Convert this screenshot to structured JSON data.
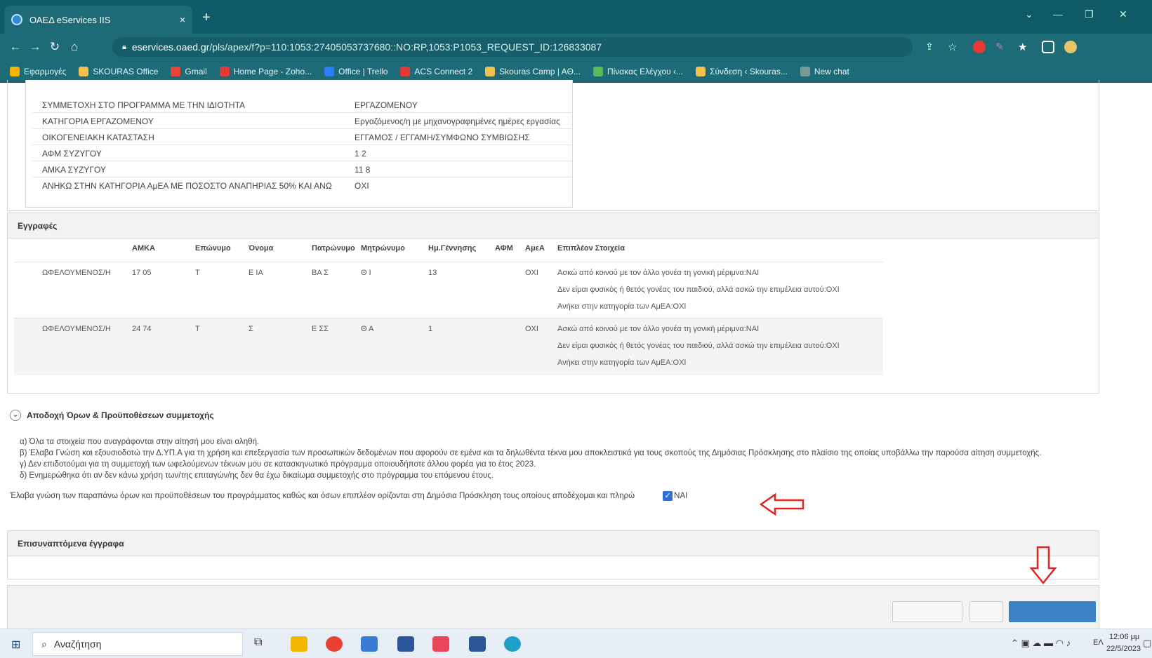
{
  "browser": {
    "tab_title": "ΟΑΕΔ eServices IIS",
    "tab_close": "×",
    "new_tab": "+",
    "url_host": "eservices.oaed.gr",
    "url_path": "/pls/apex/f?p=110:1053:27405053737680::NO:RP,1053:P1053_REQUEST_ID:126833087"
  },
  "bookmarks": [
    {
      "label": "Εφαρμογές",
      "color": "#f4b400"
    },
    {
      "label": "SKOURAS Office",
      "color": "#f2c14e"
    },
    {
      "label": "Gmail",
      "color": "#ea4335"
    },
    {
      "label": "Home Page - Zoho...",
      "color": "#e53935"
    },
    {
      "label": "Office | Trello",
      "color": "#2d7df6"
    },
    {
      "label": "ACS Connect 2",
      "color": "#e53935"
    },
    {
      "label": "Skouras Camp | AΘ...",
      "color": "#f2c14e"
    },
    {
      "label": "Πίνακας Ελέγχου ‹...",
      "color": "#5cb85c"
    },
    {
      "label": "Σύνδεση ‹ Skouras...",
      "color": "#f2c14e"
    },
    {
      "label": "New chat",
      "color": "#7a9a9a"
    }
  ],
  "details": [
    {
      "key": "ΣΥΜΜΕΤΟΧΗ ΣΤΟ ΠΡΟΓΡΑΜΜΑ ΜΕ ΤΗΝ ΙΔΙΟΤΗΤΑ",
      "value": "ΕΡΓΑΖΟΜΕΝΟΥ"
    },
    {
      "key": "ΚΑΤΗΓΟΡΙΑ ΕΡΓΑΖΟΜΕΝΟΥ",
      "value": "Εργαζόμενος/η με μηχανογραφημένες ημέρες εργασίας"
    },
    {
      "key": "ΟΙΚΟΓΕΝΕΙΑΚΗ ΚΑΤΑΣΤΑΣΗ",
      "value": "ΕΓΓΑΜΟΣ / ΕΓΓΑΜΗ/ΣΥΜΦΩΝΟ ΣΥΜΒΙΩΣΗΣ"
    },
    {
      "key": "ΑΦΜ ΣΥΖΥΓΟΥ",
      "value": "1        2"
    },
    {
      "key": "ΑΜΚΑ ΣΥΖΥΓΟΥ",
      "value": "11        8"
    },
    {
      "key": "ΑΝΗΚΩ ΣΤΗΝ ΚΑΤΗΓΟΡΙΑ ΑμΕΑ ΜΕ ΠΟΣΟΣΤΟ ΑΝΑΠΗΡΙΑΣ 50% ΚΑΙ ΑΝΩ",
      "value": "ΟΧΙ"
    }
  ],
  "registrations": {
    "title": "Εγγραφές",
    "columns": [
      "ΑΜΚΑ",
      "Επώνυμο",
      "Όνομα",
      "Πατρώνυμο",
      "Μητρώνυμο",
      "Ημ.Γέννησης",
      "ΑΦΜ",
      "ΑμεΑ",
      "Επιπλέον Στοιχεία"
    ],
    "rows": [
      {
        "role": "ΩΦΕΛΟΥΜΕΝΟΣ/Η",
        "amka": "17        05",
        "surname": "Τ",
        "name": "Ε     ΙΑ",
        "father": "ΒΑ    Σ",
        "mother": "Θ     Ι",
        "birth": "13",
        "amea": "ΟΧΙ",
        "extra": [
          "Ασκώ από κοινού με τον άλλο γονέα τη γονική μέριμνα:ΝΑΙ",
          "Δεν είμαι φυσικός ή θετός γονέας του παιδιού, αλλά ασκώ την επιμέλεια αυτού:ΟΧΙ",
          "Ανήκει στην κατηγορία των ΑμΕΑ:ΟΧΙ"
        ]
      },
      {
        "role": "ΩΦΕΛΟΥΜΕΝΟΣ/Η",
        "amka": "24        74",
        "surname": "Τ",
        "name": "Σ",
        "father": "Ε    ΣΣ",
        "mother": "Θ     Α",
        "birth": "1",
        "amea": "ΟΧΙ",
        "extra": [
          "Ασκώ από κοινού με τον άλλο γονέα τη γονική μέριμνα:ΝΑΙ",
          "Δεν είμαι φυσικός ή θετός γονέας του παιδιού, αλλά ασκώ την επιμέλεια αυτού:ΟΧΙ",
          "Ανήκει στην κατηγορία των ΑμΕΑ:ΟΧΙ"
        ]
      }
    ]
  },
  "terms": {
    "title": "Αποδοχή Όρων & Προϋποθέσεων συμμετοχής",
    "items": [
      "α) Όλα τα στοιχεία που αναγράφονται στην αίτησή μου είναι αληθή.",
      "β) Έλαβα Γνώση και εξουσιοδοτώ την Δ.ΥΠ.Α για τη χρήση και επεξεργασία των προσωπικών δεδομένων που αφορούν σε εμένα και τα δηλωθέντα τέκνα μου αποκλειστικά για τους σκοπούς της Δημόσιας Πρόσκλησης στο πλαίσιο της οποίας υποβάλλω την παρούσα αίτηση συμμετοχής.",
      "γ) Δεν επιδοτούμαι για τη συμμετοχή των ωφελούμενων τέκνων μου σε κατασκηνωτικό πρόγραμμα οποιουδήποτε άλλου φορέα για το έτος 2023.",
      "δ) Ενημερώθηκα ότι αν δεν κάνω χρήση των/της επιταγών/ης δεν θα έχω δικαίωμα συμμετοχής στο πρόγραμμα του επόμενου έτους."
    ],
    "consent_text": "Έλαβα γνώση των παραπάνω όρων και προϋποθέσεων του προγράμματος καθώς και όσων επιπλέον ορίζονται στη Δημόσια Πρόσκληση τους οποίους αποδέχομαι και πληρώ",
    "consent_label": "ΝΑΙ"
  },
  "attachments": {
    "title": "Επισυναπτόμενα έγγραφα"
  },
  "taskbar": {
    "search_placeholder": "Αναζήτηση",
    "lang": "ΕΛ",
    "time": "12:06 μμ",
    "date": "22/5/2023"
  },
  "colors": {
    "annotation_arrow": "#e02424",
    "browser_chrome": "#1d6b76",
    "checkbox": "#2f6fd6"
  }
}
